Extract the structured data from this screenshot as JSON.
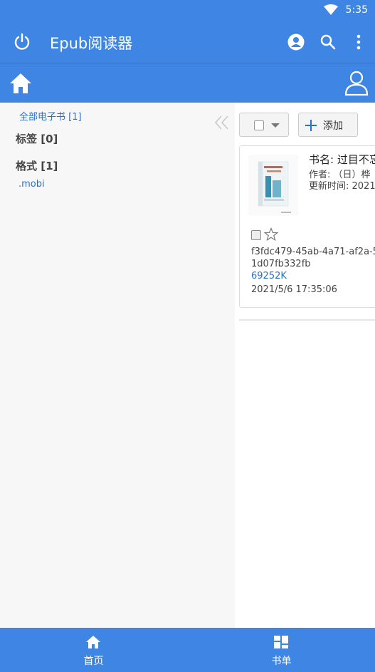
{
  "status": {
    "time": "5:35",
    "wifi_icon": "wifi-icon"
  },
  "appbar": {
    "title": "Epub阅读器",
    "power_icon": "power-icon",
    "account_icon": "account-circle-icon",
    "search_icon": "search-icon",
    "more_icon": "more-vert-icon",
    "color": "#3f86e4"
  },
  "navbar": {
    "home_icon": "home-icon",
    "user_icon": "user-icon"
  },
  "sidebar": {
    "all_books": "全部电子书 [1]",
    "tags_header": "标签 [0]",
    "formats_header": "格式 [1]",
    "format_items": [
      ".mobi"
    ],
    "collapse_icon": "double-chevron-left-icon"
  },
  "toolbar": {
    "add_label": "添加"
  },
  "books": [
    {
      "name": "书名: 过目不忘",
      "author": "作者: （日）桦",
      "updated": "更新时间: 2021",
      "hash": "f3fdc479-45ab-4a71-af2a-51d07fb332fb",
      "size": "69252K",
      "date": "2021/5/6 17:35:06"
    }
  ],
  "bottom_tabs": [
    {
      "label": "首页",
      "icon": "home-icon"
    },
    {
      "label": "书单",
      "icon": "grid-icon"
    }
  ]
}
